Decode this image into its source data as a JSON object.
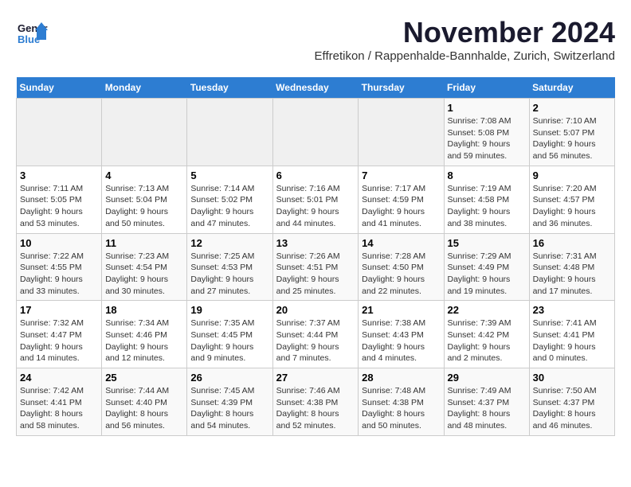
{
  "header": {
    "logo_general": "General",
    "logo_blue": "Blue",
    "month_title": "November 2024",
    "subtitle": "Effretikon / Rappenhalde-Bannhalde, Zurich, Switzerland"
  },
  "days_of_week": [
    "Sunday",
    "Monday",
    "Tuesday",
    "Wednesday",
    "Thursday",
    "Friday",
    "Saturday"
  ],
  "weeks": [
    [
      {
        "day": "",
        "info": ""
      },
      {
        "day": "",
        "info": ""
      },
      {
        "day": "",
        "info": ""
      },
      {
        "day": "",
        "info": ""
      },
      {
        "day": "",
        "info": ""
      },
      {
        "day": "1",
        "info": "Sunrise: 7:08 AM\nSunset: 5:08 PM\nDaylight: 9 hours and 59 minutes."
      },
      {
        "day": "2",
        "info": "Sunrise: 7:10 AM\nSunset: 5:07 PM\nDaylight: 9 hours and 56 minutes."
      }
    ],
    [
      {
        "day": "3",
        "info": "Sunrise: 7:11 AM\nSunset: 5:05 PM\nDaylight: 9 hours and 53 minutes."
      },
      {
        "day": "4",
        "info": "Sunrise: 7:13 AM\nSunset: 5:04 PM\nDaylight: 9 hours and 50 minutes."
      },
      {
        "day": "5",
        "info": "Sunrise: 7:14 AM\nSunset: 5:02 PM\nDaylight: 9 hours and 47 minutes."
      },
      {
        "day": "6",
        "info": "Sunrise: 7:16 AM\nSunset: 5:01 PM\nDaylight: 9 hours and 44 minutes."
      },
      {
        "day": "7",
        "info": "Sunrise: 7:17 AM\nSunset: 4:59 PM\nDaylight: 9 hours and 41 minutes."
      },
      {
        "day": "8",
        "info": "Sunrise: 7:19 AM\nSunset: 4:58 PM\nDaylight: 9 hours and 38 minutes."
      },
      {
        "day": "9",
        "info": "Sunrise: 7:20 AM\nSunset: 4:57 PM\nDaylight: 9 hours and 36 minutes."
      }
    ],
    [
      {
        "day": "10",
        "info": "Sunrise: 7:22 AM\nSunset: 4:55 PM\nDaylight: 9 hours and 33 minutes."
      },
      {
        "day": "11",
        "info": "Sunrise: 7:23 AM\nSunset: 4:54 PM\nDaylight: 9 hours and 30 minutes."
      },
      {
        "day": "12",
        "info": "Sunrise: 7:25 AM\nSunset: 4:53 PM\nDaylight: 9 hours and 27 minutes."
      },
      {
        "day": "13",
        "info": "Sunrise: 7:26 AM\nSunset: 4:51 PM\nDaylight: 9 hours and 25 minutes."
      },
      {
        "day": "14",
        "info": "Sunrise: 7:28 AM\nSunset: 4:50 PM\nDaylight: 9 hours and 22 minutes."
      },
      {
        "day": "15",
        "info": "Sunrise: 7:29 AM\nSunset: 4:49 PM\nDaylight: 9 hours and 19 minutes."
      },
      {
        "day": "16",
        "info": "Sunrise: 7:31 AM\nSunset: 4:48 PM\nDaylight: 9 hours and 17 minutes."
      }
    ],
    [
      {
        "day": "17",
        "info": "Sunrise: 7:32 AM\nSunset: 4:47 PM\nDaylight: 9 hours and 14 minutes."
      },
      {
        "day": "18",
        "info": "Sunrise: 7:34 AM\nSunset: 4:46 PM\nDaylight: 9 hours and 12 minutes."
      },
      {
        "day": "19",
        "info": "Sunrise: 7:35 AM\nSunset: 4:45 PM\nDaylight: 9 hours and 9 minutes."
      },
      {
        "day": "20",
        "info": "Sunrise: 7:37 AM\nSunset: 4:44 PM\nDaylight: 9 hours and 7 minutes."
      },
      {
        "day": "21",
        "info": "Sunrise: 7:38 AM\nSunset: 4:43 PM\nDaylight: 9 hours and 4 minutes."
      },
      {
        "day": "22",
        "info": "Sunrise: 7:39 AM\nSunset: 4:42 PM\nDaylight: 9 hours and 2 minutes."
      },
      {
        "day": "23",
        "info": "Sunrise: 7:41 AM\nSunset: 4:41 PM\nDaylight: 9 hours and 0 minutes."
      }
    ],
    [
      {
        "day": "24",
        "info": "Sunrise: 7:42 AM\nSunset: 4:41 PM\nDaylight: 8 hours and 58 minutes."
      },
      {
        "day": "25",
        "info": "Sunrise: 7:44 AM\nSunset: 4:40 PM\nDaylight: 8 hours and 56 minutes."
      },
      {
        "day": "26",
        "info": "Sunrise: 7:45 AM\nSunset: 4:39 PM\nDaylight: 8 hours and 54 minutes."
      },
      {
        "day": "27",
        "info": "Sunrise: 7:46 AM\nSunset: 4:38 PM\nDaylight: 8 hours and 52 minutes."
      },
      {
        "day": "28",
        "info": "Sunrise: 7:48 AM\nSunset: 4:38 PM\nDaylight: 8 hours and 50 minutes."
      },
      {
        "day": "29",
        "info": "Sunrise: 7:49 AM\nSunset: 4:37 PM\nDaylight: 8 hours and 48 minutes."
      },
      {
        "day": "30",
        "info": "Sunrise: 7:50 AM\nSunset: 4:37 PM\nDaylight: 8 hours and 46 minutes."
      }
    ]
  ]
}
